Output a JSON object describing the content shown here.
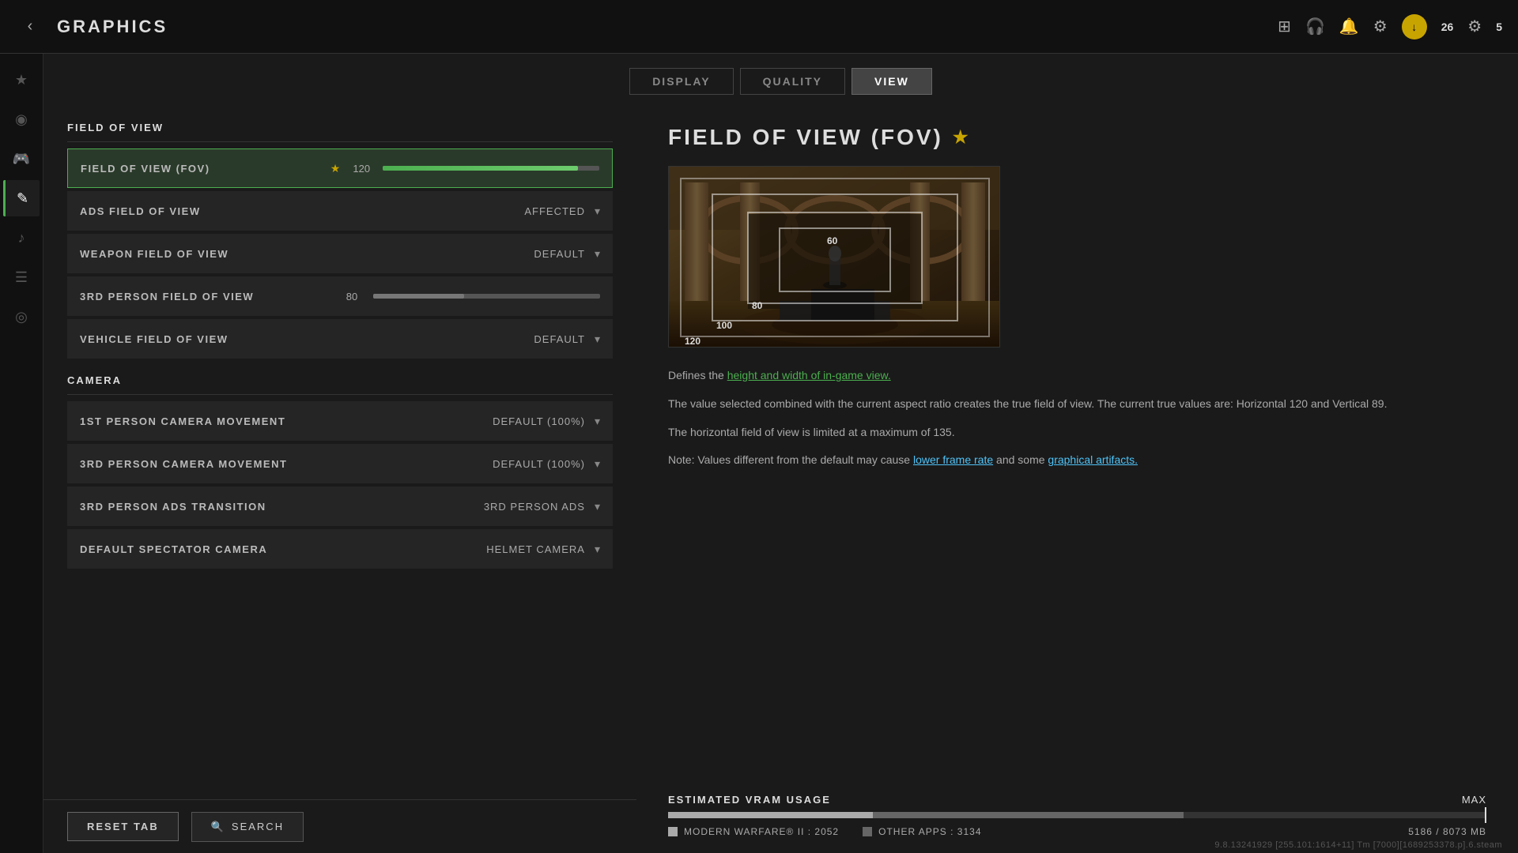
{
  "header": {
    "back_label": "‹",
    "title": "GRAPHICS",
    "icons": [
      "grid",
      "headphones",
      "bell",
      "gear"
    ],
    "download_count": "26",
    "friends_count": "5"
  },
  "tabs": [
    {
      "id": "display",
      "label": "DISPLAY",
      "active": false
    },
    {
      "id": "quality",
      "label": "QUALITY",
      "active": false
    },
    {
      "id": "view",
      "label": "VIEW",
      "active": true
    }
  ],
  "sidebar": {
    "items": [
      {
        "id": "star",
        "icon": "★",
        "active": false
      },
      {
        "id": "controller",
        "icon": "⊙",
        "active": false
      },
      {
        "id": "gamepad",
        "icon": "⌂",
        "active": false
      },
      {
        "id": "brush",
        "icon": "✎",
        "active": true
      },
      {
        "id": "speaker",
        "icon": "♪",
        "active": false
      },
      {
        "id": "list",
        "icon": "☰",
        "active": false
      },
      {
        "id": "signal",
        "icon": "◎",
        "active": false
      }
    ]
  },
  "sections": {
    "field_of_view": {
      "header": "FIELD OF VIEW",
      "settings": [
        {
          "id": "fov_main",
          "label": "FIELD OF VIEW (FOV)",
          "starred": true,
          "type": "slider",
          "value": "120",
          "fill_pct": 90,
          "highlighted": true
        },
        {
          "id": "ads_fov",
          "label": "ADS FIELD OF VIEW",
          "starred": false,
          "type": "dropdown",
          "value": "AFFECTED"
        },
        {
          "id": "weapon_fov",
          "label": "WEAPON FIELD OF VIEW",
          "starred": false,
          "type": "dropdown",
          "value": "DEFAULT"
        },
        {
          "id": "3rd_person_fov",
          "label": "3RD PERSON FIELD OF VIEW",
          "starred": false,
          "type": "slider",
          "value": "80",
          "fill_pct": 40
        },
        {
          "id": "vehicle_fov",
          "label": "VEHICLE FIELD OF VIEW",
          "starred": false,
          "type": "dropdown",
          "value": "DEFAULT"
        }
      ]
    },
    "camera": {
      "header": "CAMERA",
      "settings": [
        {
          "id": "1st_person_cam",
          "label": "1ST PERSON CAMERA MOVEMENT",
          "starred": false,
          "type": "dropdown",
          "value": "DEFAULT (100%)"
        },
        {
          "id": "3rd_person_cam",
          "label": "3RD PERSON CAMERA MOVEMENT",
          "starred": false,
          "type": "dropdown",
          "value": "DEFAULT (100%)"
        },
        {
          "id": "3rd_person_ads",
          "label": "3RD PERSON ADS TRANSITION",
          "starred": false,
          "type": "dropdown",
          "value": "3RD PERSON ADS"
        },
        {
          "id": "spectator_cam",
          "label": "DEFAULT SPECTATOR CAMERA",
          "starred": false,
          "type": "dropdown",
          "value": "HELMET CAMERA"
        }
      ]
    }
  },
  "right_panel": {
    "title": "FIELD OF VIEW (FOV)",
    "star": "★",
    "fov_labels": [
      "60",
      "80",
      "100",
      "120"
    ],
    "description_1": "Defines the height and width of in-game view.",
    "description_1_highlight": "height and width of in-game view.",
    "description_2": "The value selected combined with the current aspect ratio creates the true field of view. The current true values are: Horizontal 120 and Vertical 89.",
    "description_3": "The horizontal field of view is limited at a maximum of 135.",
    "description_4_prefix": "Note: Values different from the default may cause ",
    "description_4_link1": "lower frame rate",
    "description_4_mid": " and some ",
    "description_4_link2": "graphical artifacts.",
    "vram": {
      "title": "ESTIMATED VRAM USAGE",
      "max_label": "MAX",
      "mw_label": "MODERN WARFARE® II : 2052",
      "other_label": "OTHER APPS : 3134",
      "total": "5186 / 8073 MB",
      "mw_pct": 25,
      "other_pct": 38
    }
  },
  "bottom": {
    "reset_label": "RESET TAB",
    "search_label": "SEARCH",
    "search_icon": "🔍"
  },
  "version": {
    "text": "9.8.13241929 [255.101:1614+11] Tm [7000][1689253378.p].6.steam"
  }
}
